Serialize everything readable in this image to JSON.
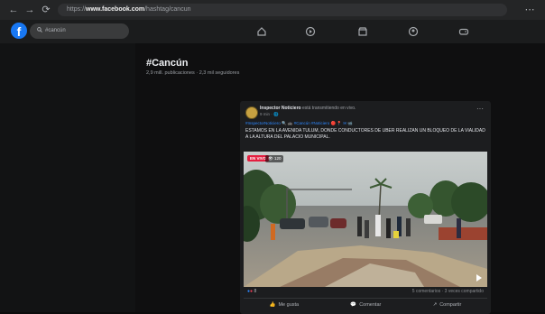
{
  "browser": {
    "url_prefix": "https://",
    "url_domain": "www.facebook.com",
    "url_path": "/hashtag/cancun"
  },
  "header": {
    "search_text": "#cancún"
  },
  "hashtag": {
    "title": "#Cancún",
    "stats": "2,9 mill. publicaciones · 2,3 mil seguidores"
  },
  "post": {
    "author": "Inspector Noticiero",
    "action": "está transmitiendo en vivo.",
    "time": "9 min",
    "tags": "#InspectorNoticiero 🔍 🚓 #Cancún #Noticiero 🔴 📍 ✉ 📹",
    "text": "ESTAMOS EN LA AVENIDA TULUM, DONDE CONDUCTORES DE UBER REALIZAN UN BLOQUEO DE LA VIALIDAD A LA ALTURA DEL PALACIO MUNICIPAL.",
    "live_label": "EN VIVO",
    "viewers": "👁 120",
    "reaction_count": "8",
    "counts": "5 comentarios · 3 veces compartido",
    "like_label": "Me gusta",
    "comment_label": "Comentar",
    "share_label": "Compartir"
  }
}
